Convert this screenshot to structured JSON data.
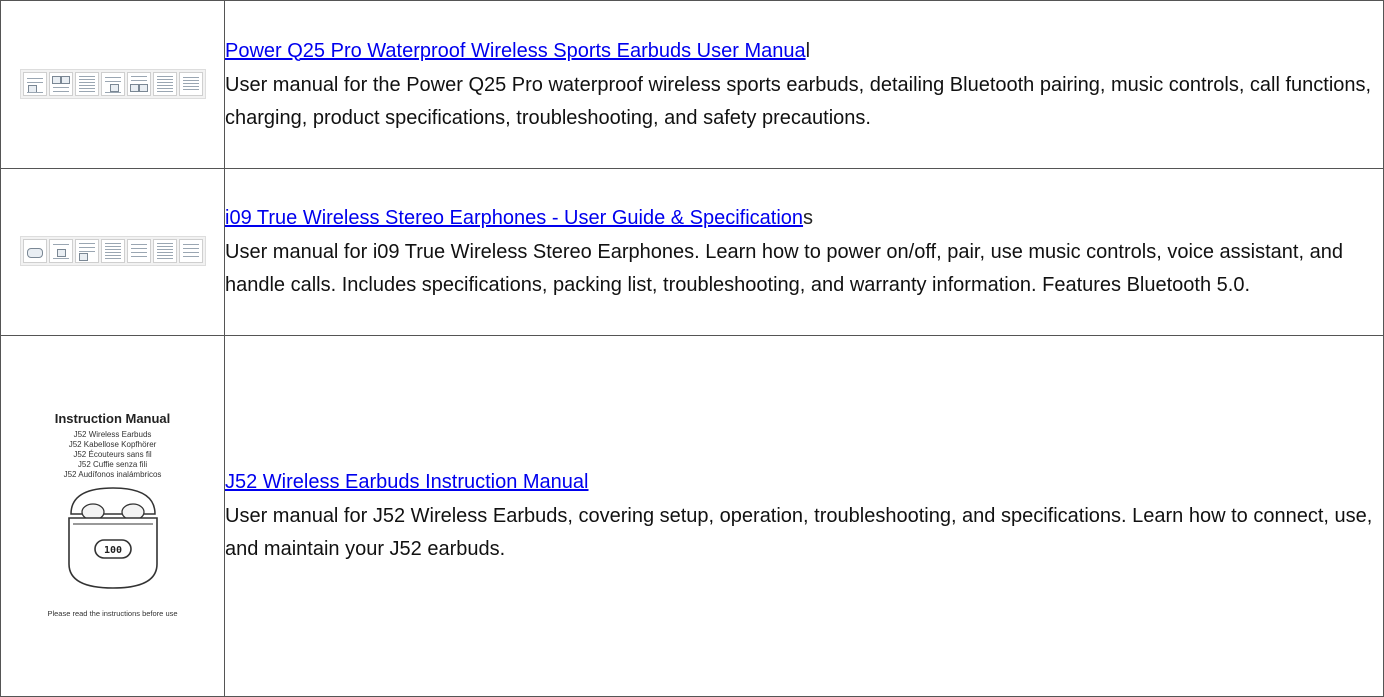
{
  "rows": [
    {
      "title": "Power Q25 Pro Waterproof Wireless Sports Earbuds User Manua",
      "title_tail": "l",
      "description": "User manual for the Power Q25 Pro waterproof wireless sports earbuds, detailing Bluetooth pairing, music controls, call functions, charging, product specifications, troubleshooting, and safety precautions."
    },
    {
      "title": "i09 True Wireless Stereo Earphones - User Guide & Specification",
      "title_tail": "s",
      "description": "User manual for i09 True Wireless Stereo Earphones. Learn how to power on/off, pair, use music controls, voice assistant, and handle calls. Includes specifications, packing list, troubleshooting, and warranty information. Features Bluetooth 5.0."
    },
    {
      "title": "J52 Wireless Earbuds Instruction Manual",
      "title_tail": "",
      "description": "User manual for J52 Wireless Earbuds, covering setup, operation, troubleshooting, and specifications. Learn how to connect, use, and maintain your J52 earbuds.",
      "cover": {
        "heading": "Instruction Manual",
        "lines": [
          "J52 Wireless Earbuds",
          "J52 Kabellose Kopfhörer",
          "J52 Écouteurs sans fil",
          "J52 Cuffie senza fili",
          "J52 Audífonos inalámbricos"
        ],
        "display": "100",
        "footer": "Please read the instructions before use"
      }
    }
  ],
  "colors": {
    "link": "#0000ee",
    "border": "#555555",
    "text": "#111111"
  }
}
